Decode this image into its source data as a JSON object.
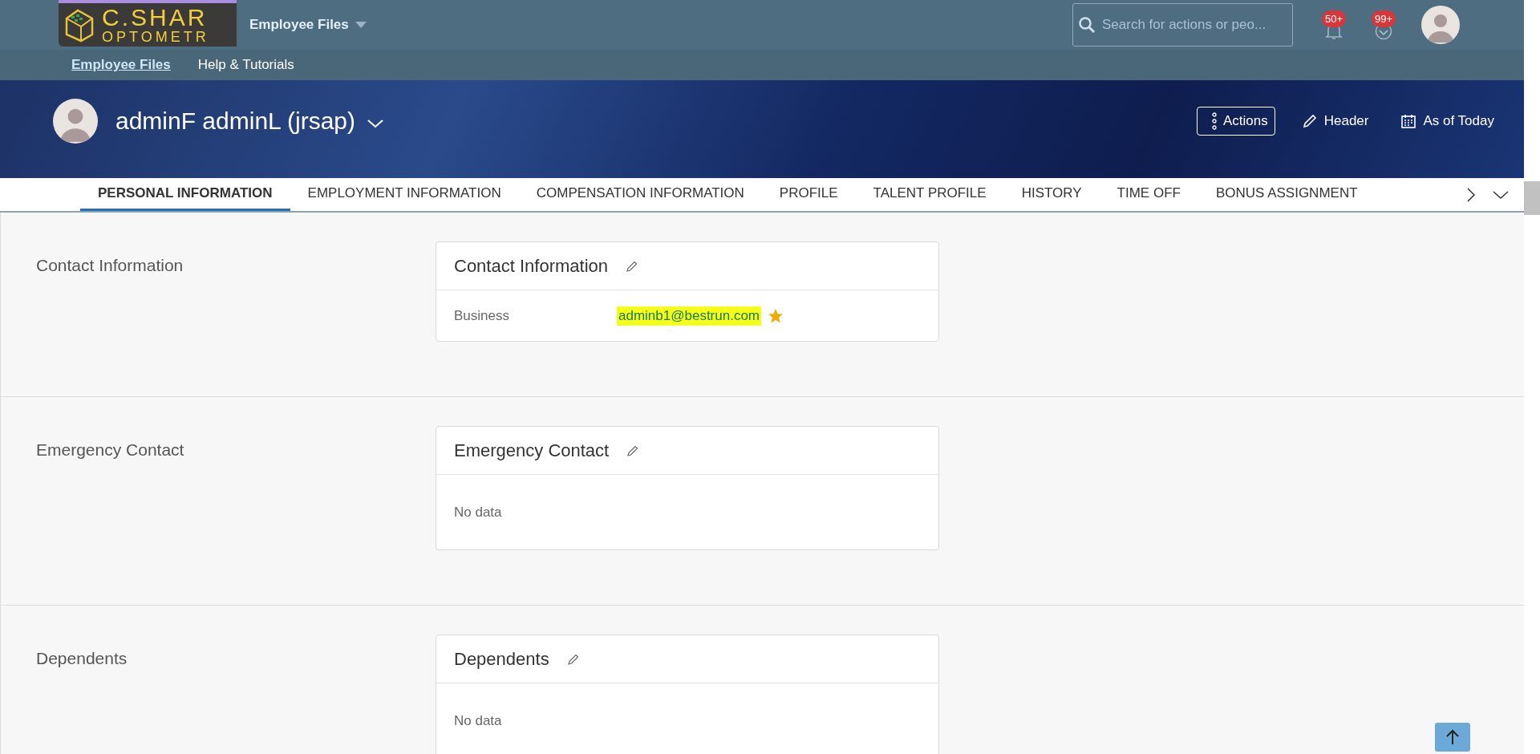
{
  "app_bar": {
    "logo_lines": [
      "C.SHAR",
      "OPTOMETR"
    ],
    "title": "Employee Files",
    "search": {
      "placeholder": "Search for actions or peo..."
    },
    "notifications": [
      {
        "kind": "bell",
        "count": "50+"
      },
      {
        "kind": "approval",
        "count": "99+"
      }
    ]
  },
  "nav": [
    {
      "label": "Employee Files",
      "selected": true
    },
    {
      "label": "Help & Tutorials",
      "selected": false
    }
  ],
  "header": {
    "name": "adminF adminL (jrsap)",
    "actions": [
      {
        "kind": "menu",
        "label": "Actions"
      },
      {
        "kind": "edit",
        "label": "Header"
      },
      {
        "kind": "calendar",
        "label": "As of Today"
      }
    ]
  },
  "tabs": [
    {
      "label": "PERSONAL INFORMATION",
      "selected": true
    },
    {
      "label": "EMPLOYMENT INFORMATION",
      "selected": false
    },
    {
      "label": "COMPENSATION INFORMATION",
      "selected": false
    },
    {
      "label": "PROFILE",
      "selected": false
    },
    {
      "label": "TALENT PROFILE",
      "selected": false
    },
    {
      "label": "HISTORY",
      "selected": false
    },
    {
      "label": "TIME OFF",
      "selected": false
    },
    {
      "label": "BONUS ASSIGNMENT",
      "selected": false
    }
  ],
  "sections": [
    {
      "label": "Contact Information",
      "card": {
        "title": "Contact Information",
        "rows": [
          {
            "label": "Business",
            "value": "adminb1@bestrun.com",
            "highlighted": true,
            "primary": true
          }
        ]
      }
    },
    {
      "label": "Emergency Contact",
      "card": {
        "title": "Emergency Contact",
        "empty": "No data"
      }
    },
    {
      "label": "Dependents",
      "card": {
        "title": "Dependents",
        "empty": "No data"
      }
    }
  ]
}
